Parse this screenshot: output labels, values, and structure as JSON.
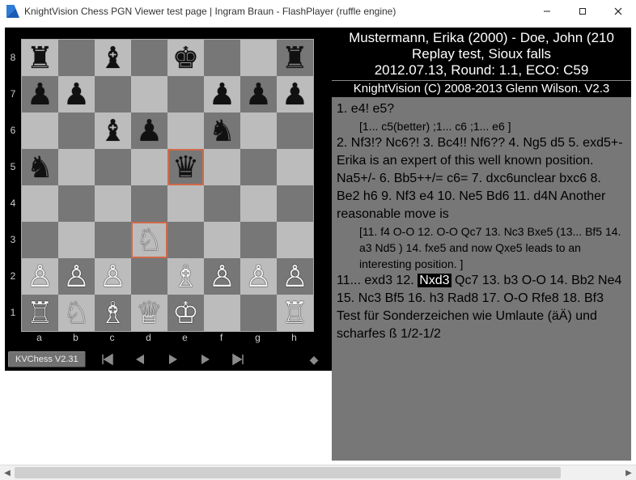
{
  "window": {
    "title": "KnightVision Chess PGN Viewer test page | Ingram Braun - FlashPlayer (ruffle engine)"
  },
  "pgn_header": {
    "players_line": "Mustermann, Erika (2000) - Doe, John (210",
    "event_line": "Replay test, Sioux falls",
    "info_line": "2012.07.13, Round: 1.1, ECO: C59"
  },
  "copyright": "KnightVision (C) 2008-2013 Glenn Wilson. V2.3",
  "version_badge": "KVChess V2.31",
  "ranks": [
    "8",
    "7",
    "6",
    "5",
    "4",
    "3",
    "2",
    "1"
  ],
  "files": [
    "a",
    "b",
    "c",
    "d",
    "e",
    "f",
    "g",
    "h"
  ],
  "board": {
    "highlights": [
      "e5",
      "d3"
    ],
    "rows": [
      "r.b.k..r",
      "pp...ppp",
      "..bp.n..",
      "n...q...",
      "........",
      "...N....",
      "PPP.BPPP",
      "RNBQK..R"
    ]
  },
  "movetext": {
    "block1_prefix": "1.  e4! e5?",
    "var1": "[1...  c5(better) ;1...  c6 ;1...  e6 ]",
    "block2": "2.  Nf3!? Nc6?! 3.  Bc4!! Nf6?? 4.  Ng5 d5 5.  exd5+- Erika is an expert of this well known position. Na5+/- 6.  Bb5++/= c6= 7.  dxc6unclear bxc6 8.  Be2 h6 9.  Nf3 e4 10.  Ne5 Bd6 11.  d4N Another reasonable move is",
    "var2": "[11.  f4 O-O 12.  O-O Qc7 13.  Nc3 Bxe5 (13...  Bf5 14.  a3 Nd5 ) 14.  fxe5 and now Qxe5 leads to an interesting position. ]",
    "seg_before_cur": "11...  exd3 12.  ",
    "current_move": "Nxd3",
    "seg_after_cur": " Qc7 13.  b3 O-O 14.  Bb2 Ne4 15.  Nc3 Bf5 16.  h3 Rad8 17.  O-O Rfe8 18.  Bf3  Test für Sonderzeichen wie Umlaute (äÄ) und scharfes ß 1/2-1/2"
  },
  "icons": {
    "first": "|◀",
    "prev": "◀",
    "play": "▶",
    "next": "▶",
    "last": "▶|",
    "flip": "◆"
  }
}
